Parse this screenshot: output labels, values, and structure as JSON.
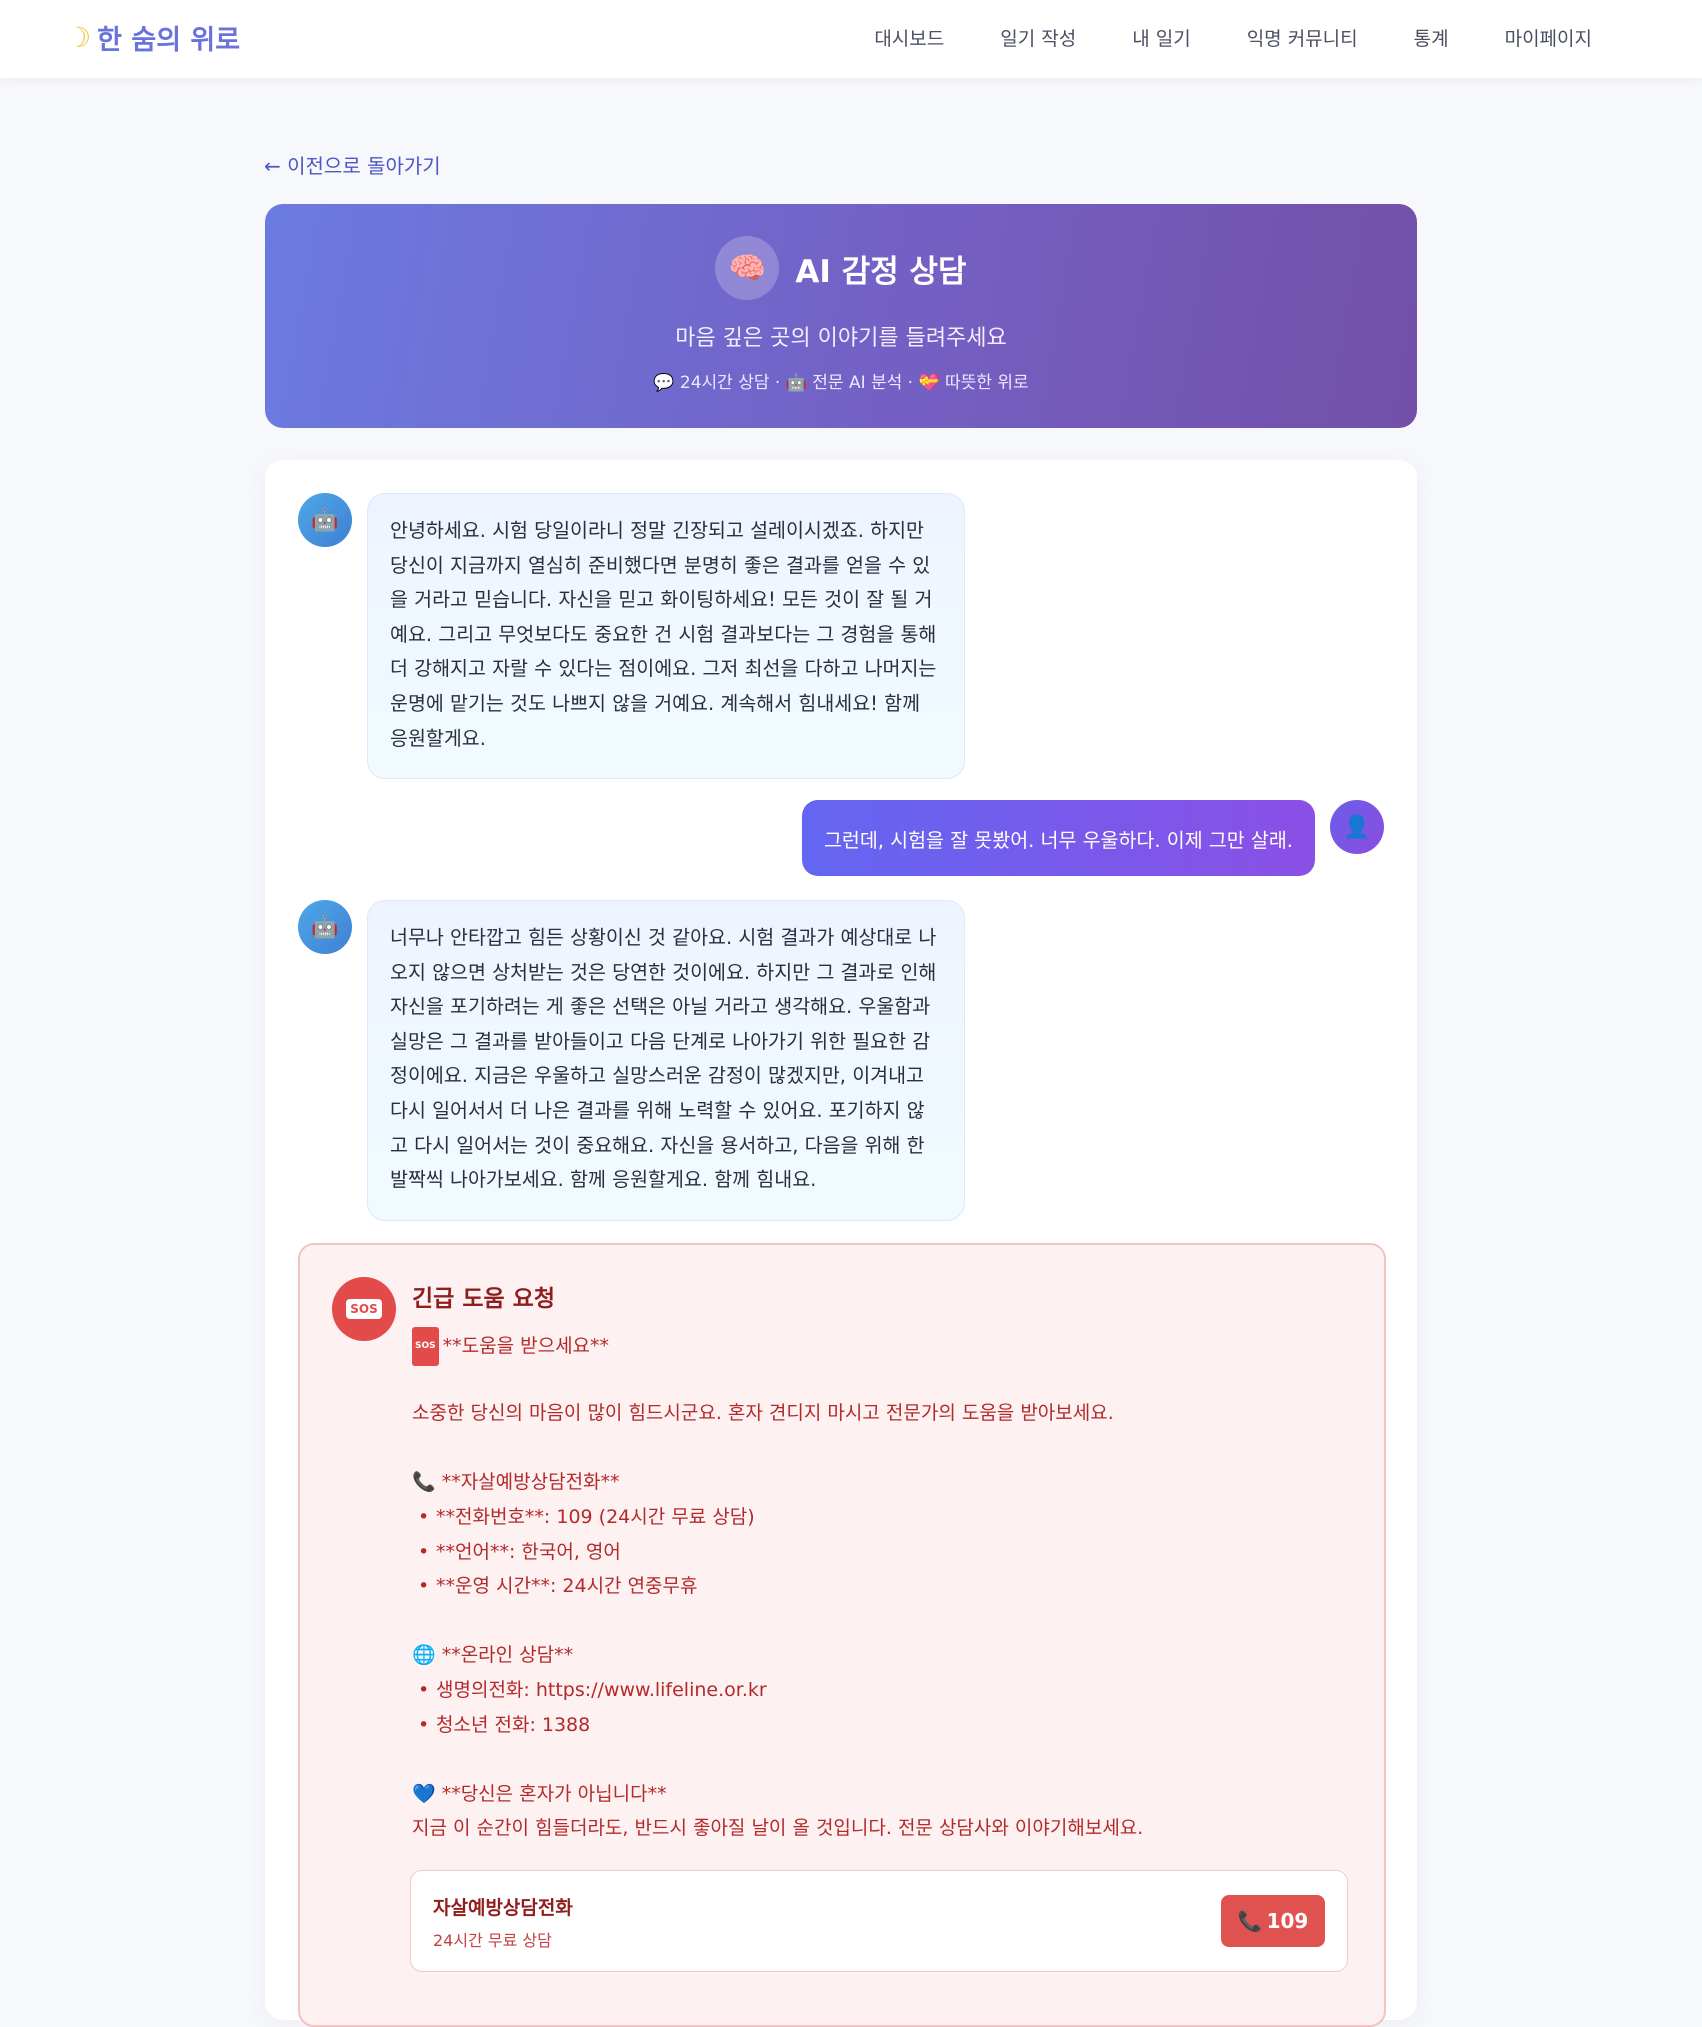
{
  "nav": {
    "brand": "한 숨의 위로",
    "links": [
      "대시보드",
      "일기 작성",
      "내 일기",
      "익명 커뮤니티",
      "통계",
      "마이페이지"
    ]
  },
  "back_link": "← 이전으로 돌아가기",
  "hero": {
    "icon": "brain-icon",
    "title": "AI 감정 상담",
    "subtitle": "마음 깊은 곳의 이야기를 들려주세요",
    "meta": "💬 24시간 상담 · 🤖 전문 AI 분석 · 💝 따뜻한 위로"
  },
  "messages": [
    {
      "sender": "ai",
      "text": "안녕하세요. 시험 당일이라니 정말 긴장되고 설레이시겠죠. 하지만 당신이 지금까지 열심히 준비했다면 분명히 좋은 결과를 얻을 수 있을 거라고 믿습니다. 자신을 믿고 화이팅하세요! 모든 것이 잘 될 거예요. 그리고 무엇보다도 중요한 건 시험 결과보다는 그 경험을 통해 더 강해지고 자랄 수 있다는 점이에요. 그저 최선을 다하고 나머지는 운명에 맡기는 것도 나쁘지 않을 거예요. 계속해서 힘내세요! 함께 응원할게요."
    },
    {
      "sender": "user",
      "text": "그런데, 시험을 잘 못봤어. 너무 우울하다. 이제 그만 살래."
    },
    {
      "sender": "ai",
      "text": "너무나 안타깝고 힘든 상황이신 것 같아요. 시험 결과가 예상대로 나오지 않으면 상처받는 것은 당연한 것이에요. 하지만 그 결과로 인해 자신을 포기하려는 게 좋은 선택은 아닐 거라고 생각해요. 우울함과 실망은 그 결과를 받아들이고 다음 단계로 나아가기 위한 필요한 감정이에요. 지금은 우울하고 실망스러운 감정이 많겠지만, 이겨내고 다시 일어서서 더 나은 결과를 위해 노력할 수 있어요. 포기하지 않고 다시 일어서는 것이 중요해요. 자신을 용서하고, 다음을 위해 한 발짝씩 나아가보세요. 함께 응원할게요. 함께 힘내요."
    }
  ],
  "crisis": {
    "badge": "SOS",
    "title": "긴급 도움 요청",
    "heading": "**도움을 받으세요**",
    "intro": "소중한 당신의 마음이 많이 힘드시군요. 혼자 견디지 마시고 전문가의 도움을 받아보세요.",
    "hotline_header": "📞 **자살예방상담전화**",
    "hotline_items": [
      "**전화번호**: 109 (24시간 무료 상담)",
      "**언어**: 한국어, 영어",
      "**운영 시간**: 24시간 연중무휴"
    ],
    "online_header": "🌐 **온라인 상담**",
    "online_items": [
      "생명의전화: https://www.lifeline.or.kr",
      "청소년 전화: 1388"
    ],
    "closing_header": "💙 **당신은 혼자가 아닙니다**",
    "closing_text": "지금 이 순간이 힘들더라도, 반드시 좋아질 날이 올 것입니다. 전문 상담사와 이야기해보세요.",
    "card": {
      "name": "자살예방상담전화",
      "desc": "24시간 무료 상담",
      "button": "109"
    }
  }
}
